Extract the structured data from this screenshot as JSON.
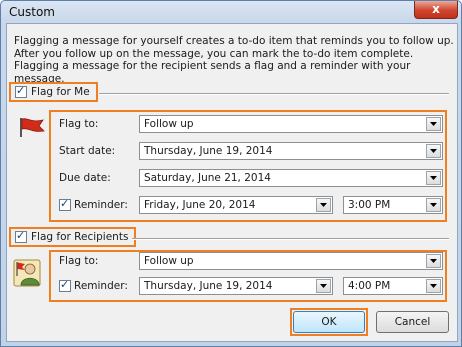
{
  "window": {
    "title": "Custom",
    "close_label": "x"
  },
  "description": "Flagging a message for yourself creates a to-do item that reminds you to follow up. After you follow up on the message, you can mark the to-do item complete. Flagging a message for the recipient sends a flag and a reminder with your message.",
  "flag_for_me": {
    "label": "Flag for Me",
    "checked": true,
    "flag_to_label": "Flag to:",
    "flag_to_value": "Follow up",
    "start_date_label": "Start date:",
    "start_date_value": "Thursday, June 19, 2014",
    "due_date_label": "Due date:",
    "due_date_value": "Saturday, June 21, 2014",
    "reminder_label": "Reminder:",
    "reminder_checked": true,
    "reminder_date": "Friday, June 20, 2014",
    "reminder_time": "3:00 PM"
  },
  "flag_for_recipients": {
    "label": "Flag for Recipients",
    "checked": true,
    "flag_to_label": "Flag to:",
    "flag_to_value": "Follow up",
    "reminder_label": "Reminder:",
    "reminder_checked": true,
    "reminder_date": "Thursday, June 19, 2014",
    "reminder_time": "4:00 PM"
  },
  "buttons": {
    "ok": "OK",
    "cancel": "Cancel"
  },
  "icons": {
    "close": "close-icon",
    "flag": "red-flag-icon",
    "recipient": "recipient-flag-icon",
    "dropdown": "chevron-down-icon",
    "check": "checkmark-icon"
  },
  "colors": {
    "highlight": "#f07f22",
    "ok_button": "#bee6fd",
    "close_button": "#c0311c"
  }
}
